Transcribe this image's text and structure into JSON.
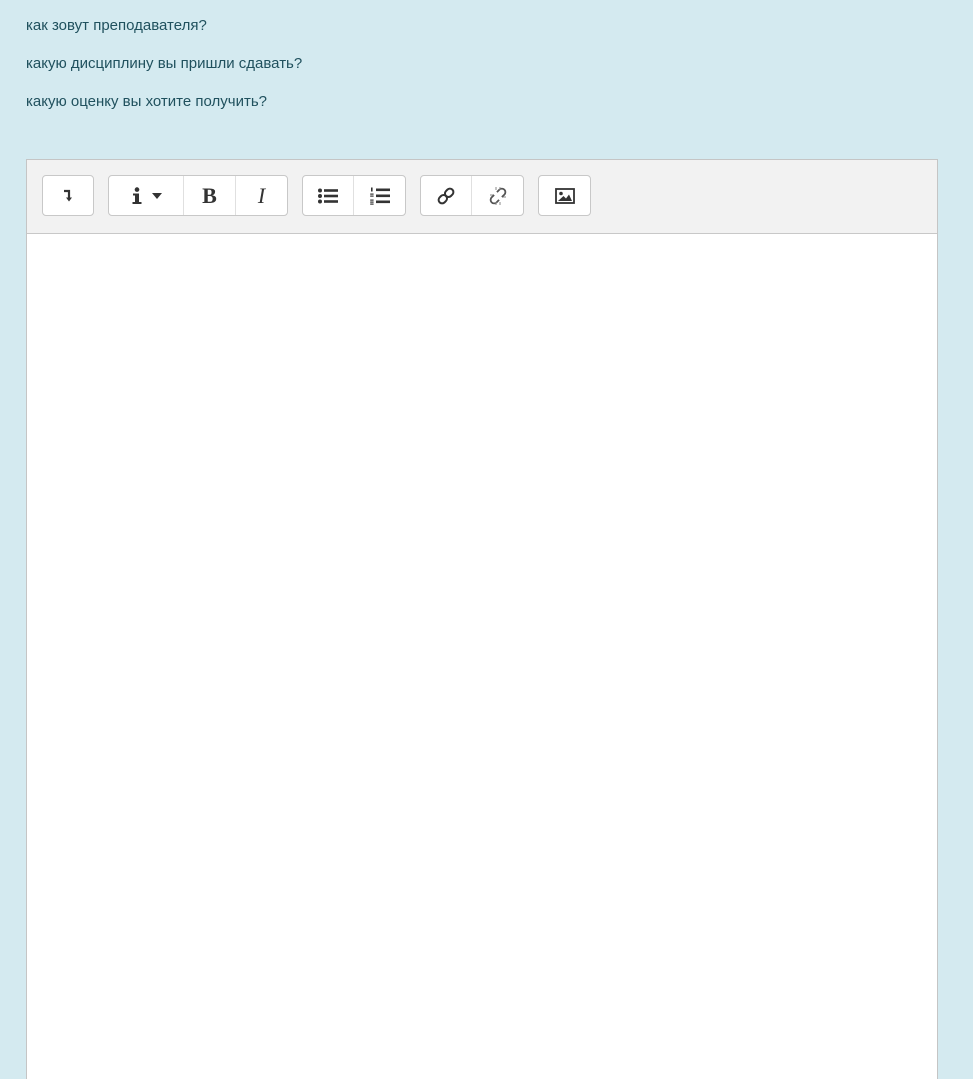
{
  "questions": [
    "как зовут преподавателя?",
    "какую дисциплину вы пришли сдавать?",
    "какую оценку вы хотите получить?"
  ],
  "toolbar": {
    "collapse_icon": "collapse-toggle-icon",
    "info_icon": "info-icon",
    "dropdown_icon": "caret-down-icon",
    "bold_label": "B",
    "italic_label": "I",
    "unordered_list_icon": "unordered-list-icon",
    "ordered_list_icon": "ordered-list-icon",
    "link_icon": "link-icon",
    "unlink_icon": "unlink-icon",
    "image_icon": "image-icon"
  },
  "editor": {
    "content": ""
  },
  "colors": {
    "page_background": "#d4eaf0",
    "question_text": "#20515e",
    "toolbar_background": "#f2f2f2",
    "editor_background": "#ffffff"
  }
}
